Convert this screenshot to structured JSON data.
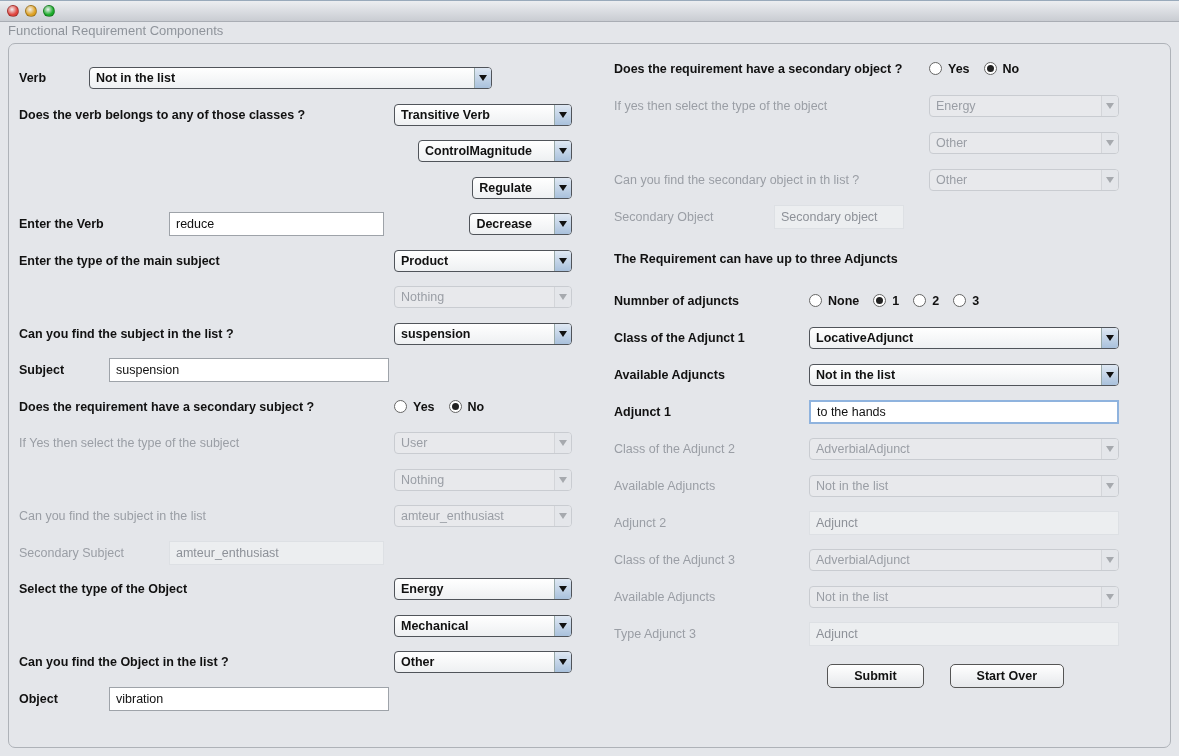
{
  "window": {
    "title": "Functional Requirement Components"
  },
  "left": [
    {
      "kind": "inline-select",
      "label": "Verb",
      "disabled": false,
      "selects": [
        {
          "value": "Not in the list",
          "disabled": false
        }
      ]
    },
    {
      "kind": "cascade",
      "label": "Does the verb belongs to any of those classes ?",
      "selects": [
        {
          "value": "Transitive Verb",
          "disabled": false
        },
        {
          "value": "ControlMagnitude",
          "disabled": false
        },
        {
          "value": "Regulate",
          "disabled": false
        },
        {
          "value": "Decrease",
          "disabled": false
        }
      ],
      "field": {
        "label": "Enter the Verb",
        "value": "reduce",
        "disabled": false,
        "focused": false
      }
    },
    {
      "kind": "select",
      "label": "Enter the type of the main subject",
      "disabled": false,
      "selects": [
        {
          "value": "Product",
          "disabled": false
        },
        {
          "value": "Nothing",
          "disabled": true
        }
      ]
    },
    {
      "kind": "select",
      "label": "Can you find the subject in the list ?",
      "disabled": false,
      "selects": [
        {
          "value": "suspension",
          "disabled": false
        }
      ]
    },
    {
      "kind": "text",
      "label": "Subject",
      "value": "suspension",
      "disabled": false,
      "focused": false
    },
    {
      "kind": "radio",
      "label": "Does the requirement have a secondary subject ?",
      "options": [
        {
          "label": "Yes",
          "selected": false
        },
        {
          "label": "No",
          "selected": true
        }
      ]
    },
    {
      "kind": "select",
      "label": "If Yes then select the type of the subject",
      "disabled": true,
      "selects": [
        {
          "value": "User",
          "disabled": true
        },
        {
          "value": "Nothing",
          "disabled": true
        }
      ]
    },
    {
      "kind": "select",
      "label": "Can you find the subject in the list",
      "disabled": true,
      "selects": [
        {
          "value": "amteur_enthusiast",
          "disabled": true
        }
      ]
    },
    {
      "kind": "text",
      "label": "Secondary Subject",
      "value": "amteur_enthusiast",
      "disabled": true,
      "focused": false
    },
    {
      "kind": "select",
      "label": "Select the type of the Object",
      "disabled": false,
      "selects": [
        {
          "value": "Energy",
          "disabled": false
        },
        {
          "value": "Mechanical",
          "disabled": false
        }
      ]
    },
    {
      "kind": "select",
      "label": "Can you find the Object in the list ?",
      "disabled": false,
      "selects": [
        {
          "value": "Other",
          "disabled": false
        }
      ]
    },
    {
      "kind": "text",
      "label": "Object",
      "value": "vibration",
      "disabled": false,
      "focused": false
    }
  ],
  "right": [
    {
      "kind": "radio",
      "label": "Does the requirement have a secondary object ?",
      "options": [
        {
          "label": "Yes",
          "selected": false
        },
        {
          "label": "No",
          "selected": true
        }
      ]
    },
    {
      "kind": "select",
      "label": "If yes then select the type of the object",
      "disabled": true,
      "selects": [
        {
          "value": "Energy",
          "disabled": true
        },
        {
          "value": "Other",
          "disabled": true
        }
      ]
    },
    {
      "kind": "select",
      "label": "Can you find the secondary object in th list ?",
      "disabled": true,
      "selects": [
        {
          "value": "Other",
          "disabled": true
        }
      ]
    },
    {
      "kind": "text",
      "label": "Secondary Object",
      "value": "Secondary object",
      "disabled": true,
      "focused": false
    },
    {
      "kind": "heading",
      "label": "The Requirement can have up to three Adjuncts"
    },
    {
      "kind": "radio",
      "label": "Numnber of adjuncts",
      "options": [
        {
          "label": "None",
          "selected": false
        },
        {
          "label": "1",
          "selected": true
        },
        {
          "label": "2",
          "selected": false
        },
        {
          "label": "3",
          "selected": false
        }
      ]
    },
    {
      "kind": "select",
      "label": "Class of the Adjunct 1",
      "disabled": false,
      "selects": [
        {
          "value": "LocativeAdjunct",
          "disabled": false
        }
      ]
    },
    {
      "kind": "select",
      "label": "Available Adjuncts",
      "disabled": false,
      "selects": [
        {
          "value": "Not in the list",
          "disabled": false
        }
      ]
    },
    {
      "kind": "text",
      "label": "Adjunct 1",
      "value": "to the hands",
      "disabled": false,
      "focused": true
    },
    {
      "kind": "select",
      "label": "Class of the Adjunct 2",
      "disabled": true,
      "selects": [
        {
          "value": "AdverbialAdjunct",
          "disabled": true
        }
      ]
    },
    {
      "kind": "select",
      "label": "Available Adjuncts",
      "disabled": true,
      "selects": [
        {
          "value": "Not in the list",
          "disabled": true
        }
      ]
    },
    {
      "kind": "text",
      "label": "Adjunct 2",
      "value": "Adjunct",
      "disabled": true,
      "focused": false
    },
    {
      "kind": "select",
      "label": "Class of the Adjunct 3",
      "disabled": true,
      "selects": [
        {
          "value": "AdverbialAdjunct",
          "disabled": true
        }
      ]
    },
    {
      "kind": "select",
      "label": "Available Adjuncts",
      "disabled": true,
      "selects": [
        {
          "value": "Not in the list",
          "disabled": true
        }
      ]
    },
    {
      "kind": "text",
      "label": "Type Adjunct 3",
      "value": "Adjunct",
      "disabled": true,
      "focused": false
    },
    {
      "kind": "buttons",
      "buttons": [
        "Submit",
        "Start Over"
      ]
    }
  ]
}
